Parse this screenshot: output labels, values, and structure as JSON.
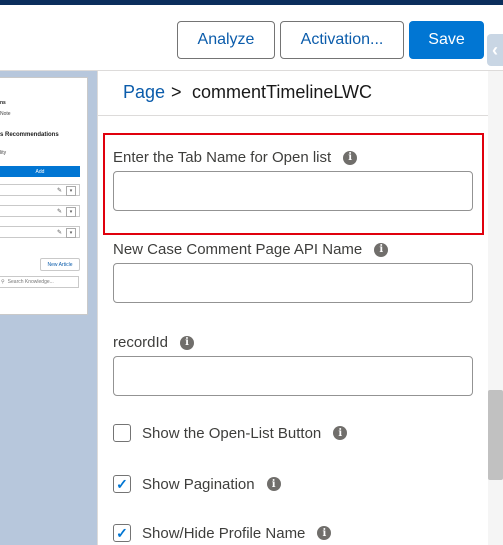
{
  "header": {
    "analyze_label": "Analyze",
    "activation_label": "Activation...",
    "save_label": "Save",
    "collapse_glyph": "‹"
  },
  "canvas_preview": {
    "line1": "ns",
    "line2": "Note",
    "section_title": "s Recommendations",
    "line3": "lity",
    "add_label": "Add",
    "new_article_label": "New Article",
    "search_placeholder": "Search Knowledge..."
  },
  "breadcrumb": {
    "root": "Page",
    "separator": ">",
    "current": "commentTimelineLWC"
  },
  "fields": [
    {
      "label": "Enter the Tab Name for Open list",
      "value": ""
    },
    {
      "label": "New Case Comment Page API Name",
      "value": ""
    },
    {
      "label": "recordId",
      "value": ""
    }
  ],
  "checkboxes": [
    {
      "label": "Show the Open-List Button",
      "checked": false
    },
    {
      "label": "Show Pagination",
      "checked": true
    },
    {
      "label": "Show/Hide Profile Name",
      "checked": true
    }
  ],
  "info_glyph": "i",
  "check_glyph": "✓",
  "colors": {
    "brand": "#0176d3",
    "link": "#0b5cab",
    "highlight": "#e0000d"
  }
}
